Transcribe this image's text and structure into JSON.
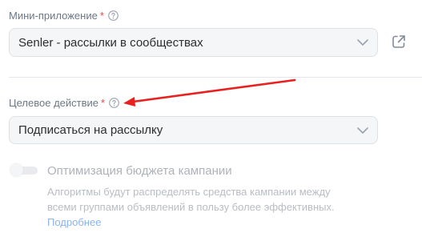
{
  "mini_app": {
    "label": "Мини-приложение",
    "required_mark": "*",
    "value": "Senler - рассылки в сообществах"
  },
  "target_action": {
    "label": "Целевое действие",
    "required_mark": "*",
    "value": "Подписаться на рассылку"
  },
  "budget_optimization": {
    "label": "Оптимизация бюджета кампании",
    "enabled": false,
    "description": "Алгоритмы будут распределять средства кампании между всеми группами объявлений в пользу более эффективных.",
    "more_link": "Подробнее"
  },
  "icons": {
    "help": "question-circle-icon",
    "dropdown": "chevron-down-icon",
    "external_link": "external-link-icon"
  },
  "colors": {
    "required": "#e64646",
    "annotation_arrow": "#e8211f",
    "link": "#8ab4ee",
    "field_background": "#f5f6f8"
  }
}
